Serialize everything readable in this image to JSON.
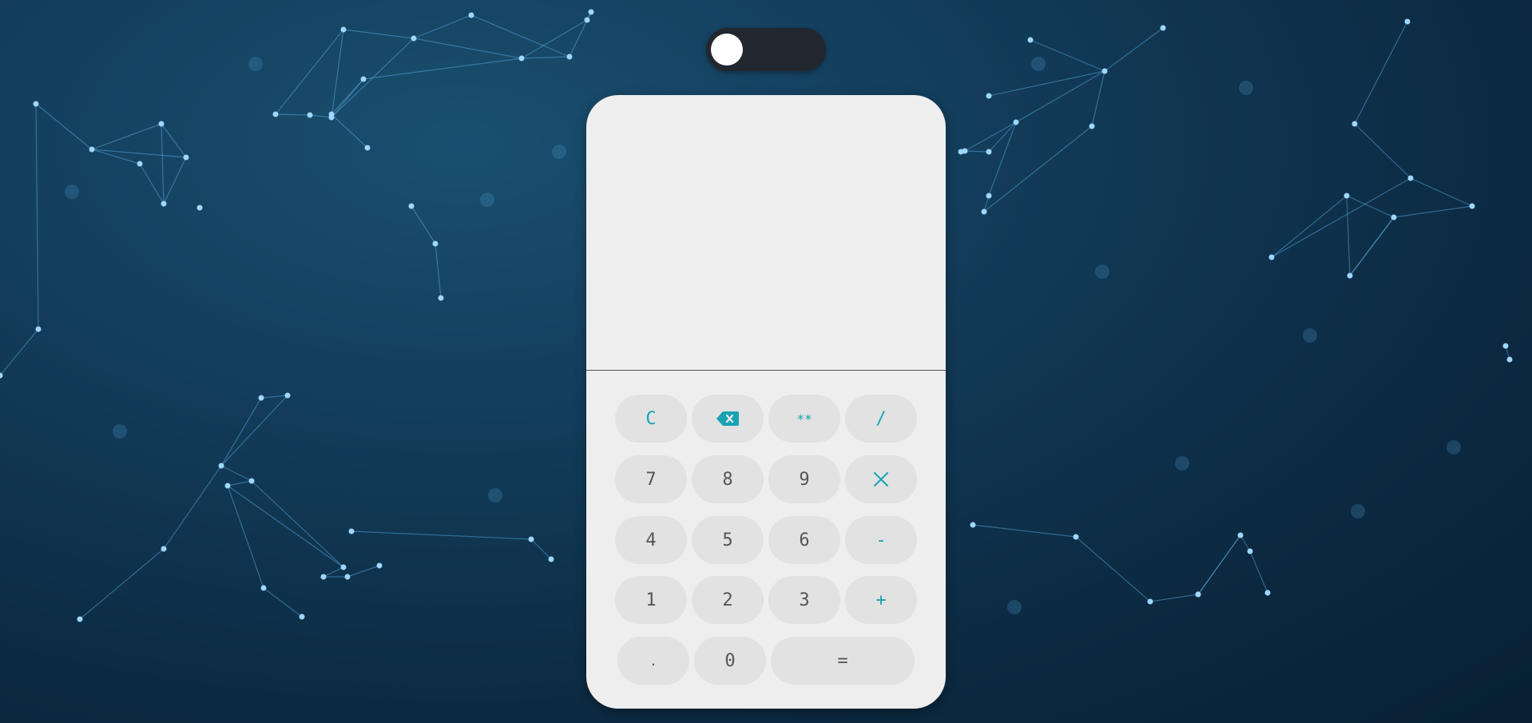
{
  "theme": {
    "accent": "#19a3b3",
    "panel": "#eeeeee",
    "key": "#e2e2e2",
    "toggle_track": "#22262e"
  },
  "toggle": {
    "icon": "theme-toggle",
    "state": "off"
  },
  "display": {
    "value": ""
  },
  "keys": {
    "clear": "C",
    "backspace_icon": "backspace-icon",
    "power": "**",
    "divide": "/",
    "seven": "7",
    "eight": "8",
    "nine": "9",
    "multiply_icon": "times-icon",
    "four": "4",
    "five": "5",
    "six": "6",
    "minus": "-",
    "one": "1",
    "two": "2",
    "three": "3",
    "plus": "+",
    "dot": ".",
    "zero": "0",
    "equals": "="
  }
}
